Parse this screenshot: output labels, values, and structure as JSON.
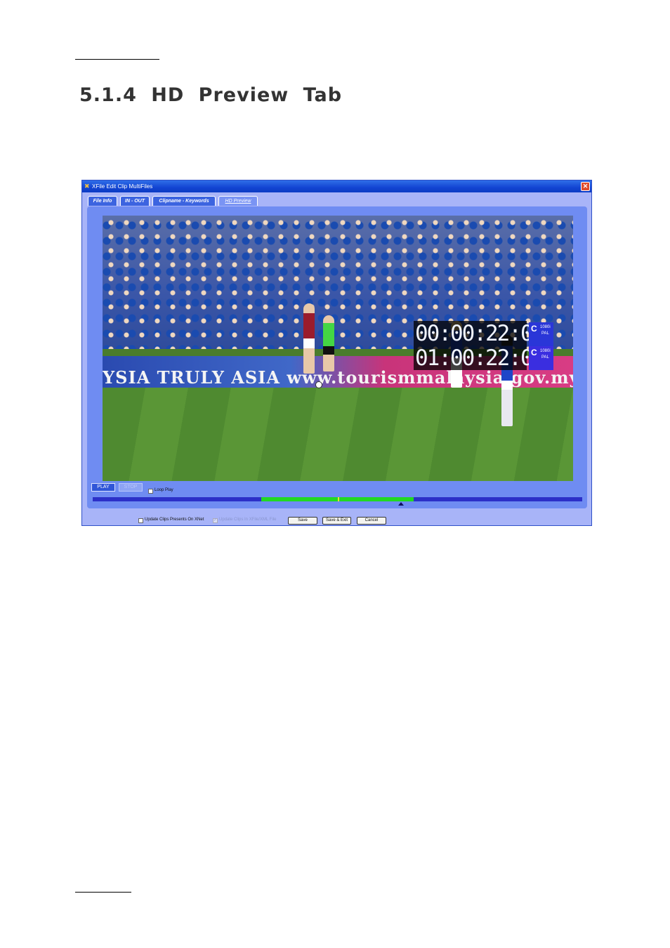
{
  "section": {
    "heading": "5.1.4 HD Preview Tab"
  },
  "window": {
    "title": "XFile Edit Clip MultiFiles",
    "close_glyph": "✕",
    "app_icon_glyph": "✖",
    "tabs": [
      {
        "label": "File Info",
        "active": false
      },
      {
        "label": "IN - OUT",
        "active": false
      },
      {
        "label": "Clipname - Keywords",
        "active": false
      },
      {
        "label": "HD Preview",
        "active": true
      }
    ],
    "preview": {
      "ad_text": "YSIA TRULY ASIA  www.tourismmalaysia.gov.my",
      "timecode_1": "00:00:22:08",
      "timecode_2": "01:00:22:08",
      "format_1": {
        "letter": "C",
        "line1": "1080i",
        "line2": "PAL"
      },
      "format_2": {
        "letter": "C",
        "line1": "1080i",
        "line2": "PAL"
      }
    },
    "controls": {
      "play_label": "PLAY",
      "stop_label": "STOP",
      "loop_label": "Loop Play",
      "loop_checked": false,
      "timeline": {
        "range_start": 0.345,
        "range_end": 0.656,
        "mark": 0.5,
        "playhead": 0.63
      }
    },
    "footer": {
      "update_label": "Update Clips Presents On XNet",
      "update_checked": false,
      "disabled_label": "Update Clips In XFile/XML File",
      "disabled_checked": true,
      "save_label": "Save",
      "save_exit_label": "Save & Exit",
      "cancel_label": "Cancel"
    },
    "colors": {
      "titlebar": "#1244d2",
      "panel": "#6f8cf2",
      "window_bg": "#a8b4f8",
      "timeline": "#2c30c8",
      "timeline_range": "#22d822"
    }
  }
}
